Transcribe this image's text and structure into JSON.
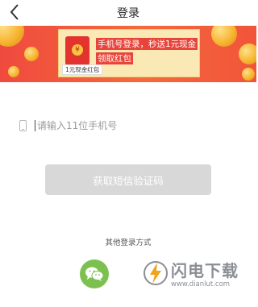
{
  "header": {
    "title": "登录"
  },
  "banner": {
    "line1": "手机号登录，秒送1元现金",
    "line2": "领取红包",
    "tag": "1元现金红包",
    "envelope_symbol": "¥"
  },
  "phone": {
    "placeholder": "请输入11位手机号",
    "value": ""
  },
  "sms_button": {
    "label": "获取短信验证码",
    "enabled": false
  },
  "other_login": {
    "label": "其他登录方式",
    "options": [
      "wechat-icon"
    ]
  },
  "watermark": {
    "title": "闪电下载",
    "url": "www.dianlut.com"
  },
  "colors": {
    "banner_red": "#f04a3e",
    "card": "#fbe9b5",
    "button_disabled": "#d8d8d8",
    "wechat_green": "#7cc150"
  }
}
